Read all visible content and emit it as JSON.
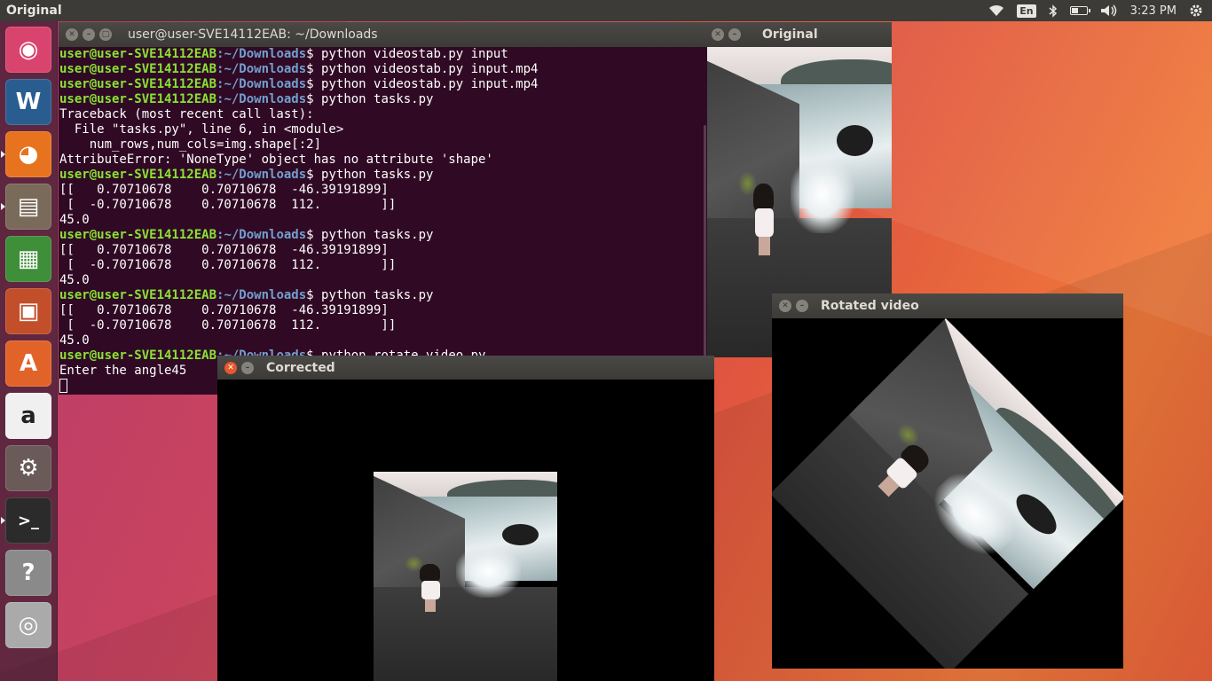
{
  "top_panel": {
    "app_title": "Original",
    "lang": "En",
    "time": "3:23 PM",
    "icons": [
      "wifi-icon",
      "bluetooth-icon",
      "battery-icon",
      "volume-icon",
      "settings-gear-icon"
    ],
    "battery_level": 0.45
  },
  "launcher": {
    "items": [
      {
        "name": "ubuntu-dash-icon",
        "glyph": "◉"
      },
      {
        "name": "libreoffice-writer-icon",
        "glyph": "W"
      },
      {
        "name": "firefox-icon",
        "glyph": "◕"
      },
      {
        "name": "files-icon",
        "glyph": "▤"
      },
      {
        "name": "libreoffice-calc-icon",
        "glyph": "▦"
      },
      {
        "name": "libreoffice-impress-icon",
        "glyph": "▣"
      },
      {
        "name": "ubuntu-software-icon",
        "glyph": "A"
      },
      {
        "name": "amazon-icon",
        "glyph": "a"
      },
      {
        "name": "system-settings-icon",
        "glyph": "⚙"
      },
      {
        "name": "terminal-icon",
        "glyph": ">_"
      },
      {
        "name": "help-icon",
        "glyph": "?"
      },
      {
        "name": "dvd-drive-icon",
        "glyph": "◎"
      }
    ]
  },
  "terminal": {
    "title": "user@user-SVE14112EAB: ~/Downloads",
    "prompt_user": "user@user-SVE14112EAB",
    "prompt_path": ":~/Downloads",
    "lines": [
      {
        "kind": "cmd",
        "text": "$ python videostab.py input"
      },
      {
        "kind": "cmd",
        "text": "$ python videostab.py input.mp4"
      },
      {
        "kind": "cmd",
        "text": "$ python videostab.py input.mp4"
      },
      {
        "kind": "cmd",
        "text": "$ python tasks.py"
      },
      {
        "kind": "out",
        "text": "Traceback (most recent call last):"
      },
      {
        "kind": "out",
        "text": "  File \"tasks.py\", line 6, in <module>"
      },
      {
        "kind": "out",
        "text": "    num_rows,num_cols=img.shape[:2]"
      },
      {
        "kind": "out",
        "text": "AttributeError: 'NoneType' object has no attribute 'shape'"
      },
      {
        "kind": "cmd",
        "text": "$ python tasks.py"
      },
      {
        "kind": "out",
        "text": "[[   0.70710678    0.70710678  -46.39191899]"
      },
      {
        "kind": "out",
        "text": " [  -0.70710678    0.70710678  112.        ]]"
      },
      {
        "kind": "out",
        "text": "45.0"
      },
      {
        "kind": "cmd",
        "text": "$ python tasks.py"
      },
      {
        "kind": "out",
        "text": "[[   0.70710678    0.70710678  -46.39191899]"
      },
      {
        "kind": "out",
        "text": " [  -0.70710678    0.70710678  112.        ]]"
      },
      {
        "kind": "out",
        "text": "45.0"
      },
      {
        "kind": "cmd",
        "text": "$ python tasks.py"
      },
      {
        "kind": "out",
        "text": "[[   0.70710678    0.70710678  -46.39191899]"
      },
      {
        "kind": "out",
        "text": " [  -0.70710678    0.70710678  112.        ]]"
      },
      {
        "kind": "out",
        "text": "45.0"
      },
      {
        "kind": "cmd",
        "text": "$ python rotate_video.py"
      },
      {
        "kind": "out",
        "text": "Enter the angle45"
      }
    ]
  },
  "windows": {
    "original": {
      "title": "Original"
    },
    "corrected": {
      "title": "Corrected"
    },
    "rotated": {
      "title": "Rotated video"
    }
  }
}
